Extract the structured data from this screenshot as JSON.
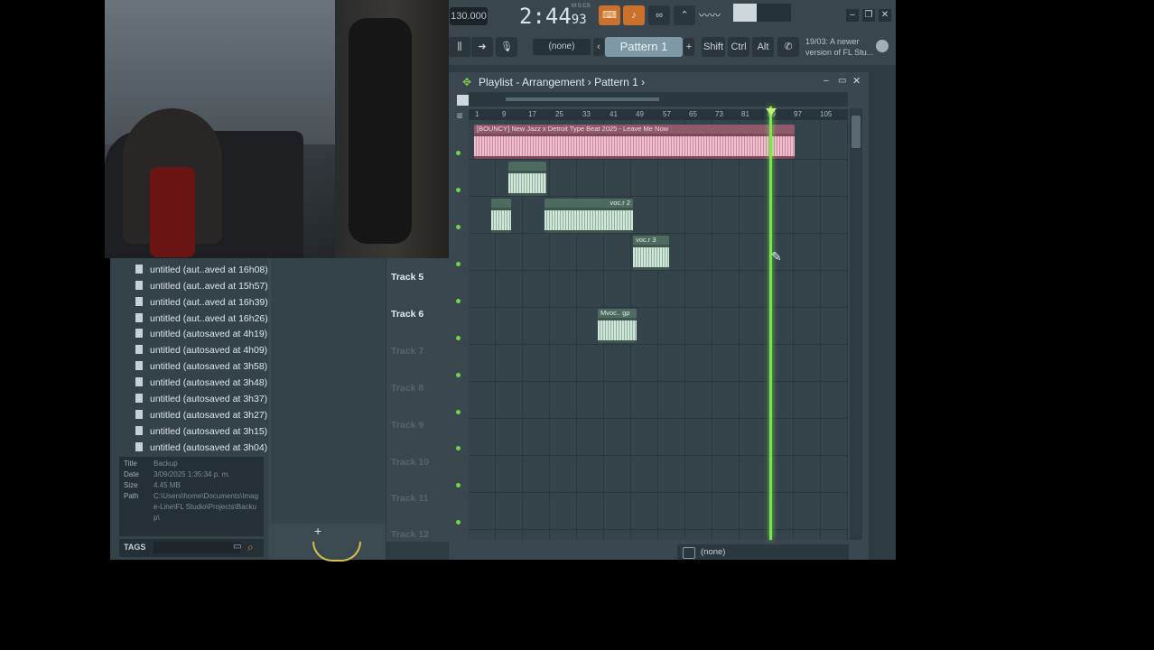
{
  "toolbar": {
    "tempo": "130.000",
    "time_main": "2:44",
    "time_frac": "93",
    "time_unit": "M:S:CS",
    "pattern_selector": "(none)",
    "pattern_name": "Pattern 1",
    "keys": [
      "Shift",
      "Ctrl",
      "Alt"
    ],
    "news": "19/03: A newer version of FL Stu..."
  },
  "browser": {
    "files": [
      "untitled (aut..aved at 16h08)",
      "untitled (aut..aved at 15h57)",
      "untitled (aut..aved at 16h39)",
      "untitled (aut..aved at 16h26)",
      "untitled (autosaved at 4h19)",
      "untitled (autosaved at 4h09)",
      "untitled (autosaved at 3h58)",
      "untitled (autosaved at 3h48)",
      "untitled (autosaved at 3h37)",
      "untitled (autosaved at 3h27)",
      "untitled (autosaved at 3h15)",
      "untitled (autosaved at 3h04)"
    ],
    "info": {
      "title_label": "Title",
      "title_value": "Backup",
      "date_label": "Date",
      "date_value": "3/09/2025 1:35:34 p. m.",
      "size_label": "Size",
      "size_value": "4.45 MB",
      "path_label": "Path",
      "path_value": "C:\\Users\\home\\Documents\\Image-Line\\FL Studio\\Projects\\Backup\\"
    },
    "tags_label": "TAGS"
  },
  "playlist": {
    "title_prefix": "Playlist",
    "title_main": "Arrangement",
    "title_sep": "›",
    "pattern": "Pattern 1",
    "ruler": [
      "1",
      "9",
      "17",
      "25",
      "33",
      "41",
      "49",
      "57",
      "65",
      "73",
      "81",
      "89",
      "97",
      "105"
    ],
    "tracks": [
      {
        "label": "Track 5"
      },
      {
        "label": "Track 6"
      },
      {
        "label": "Track 7"
      },
      {
        "label": "Track 8"
      },
      {
        "label": "Track 9"
      },
      {
        "label": "Track 10"
      },
      {
        "label": "Track 11"
      },
      {
        "label": "Track 12"
      }
    ],
    "clips": {
      "main": "[BOUNCY] New Jazz x Detroit Type Beat 2025 - Leave Me Now",
      "vocal2": "voc.r 2",
      "vocal3": "voc.r 3",
      "vocal_small": "Mvoc.. gp"
    }
  },
  "bottom_bar": {
    "value": "(none)"
  }
}
